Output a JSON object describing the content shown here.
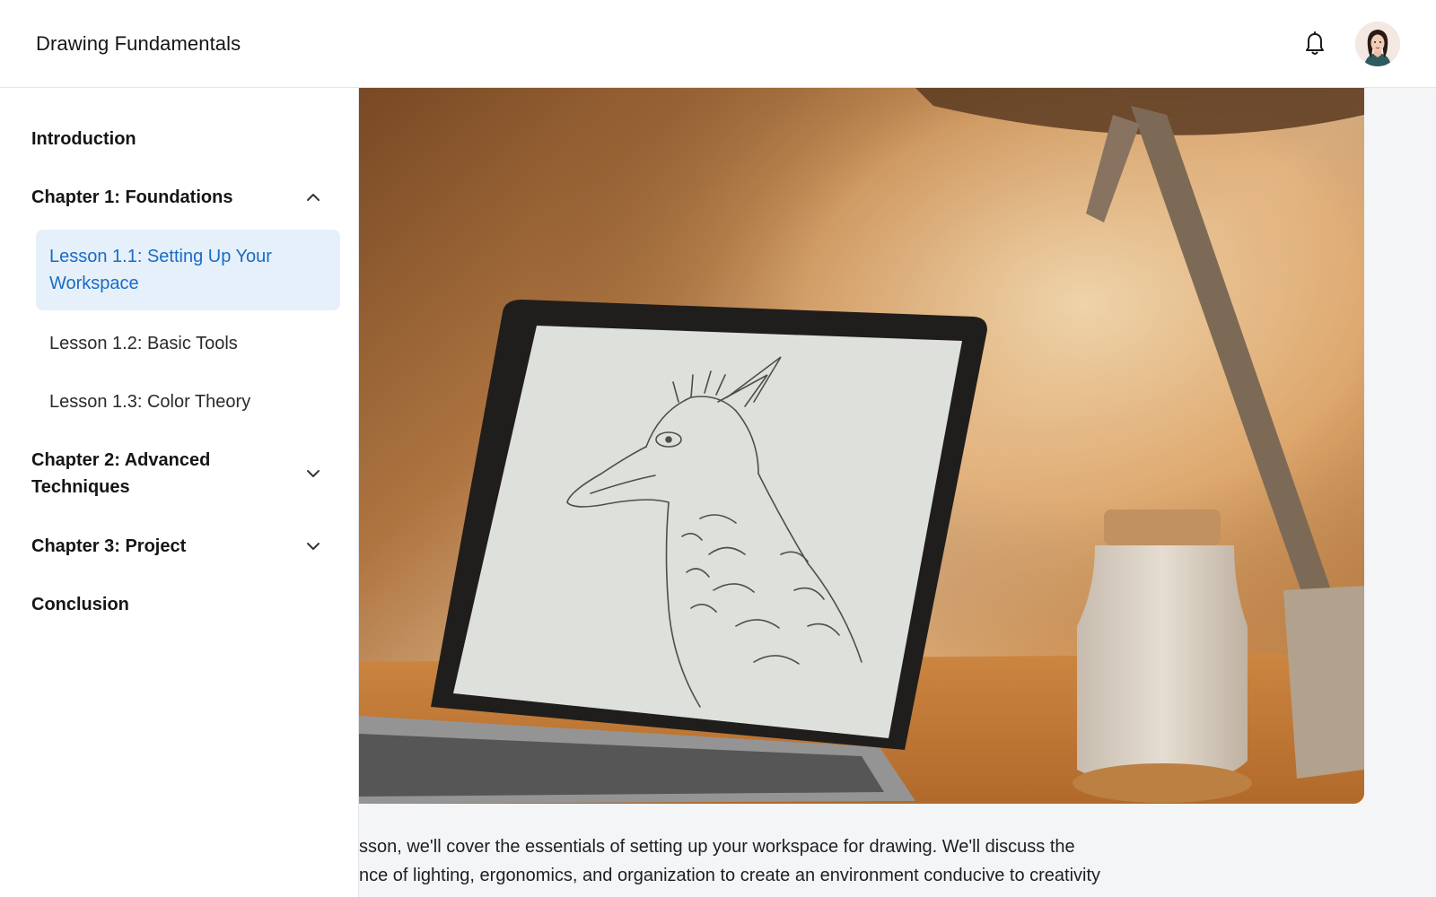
{
  "header": {
    "title": "Drawing Fundamentals",
    "icons": {
      "notifications": "bell-icon",
      "profile": "user-avatar"
    }
  },
  "sidebar": {
    "introduction": "Introduction",
    "chapter1": {
      "label": "Chapter 1: Foundations",
      "expanded": true,
      "lessons": [
        "Lesson 1.1: Setting Up Your Workspace",
        "Lesson 1.2: Basic Tools",
        "Lesson 1.3: Color Theory"
      ],
      "active_lesson": 0
    },
    "chapter2": {
      "label": "Chapter 2: Advanced Techniques",
      "expanded": false
    },
    "chapter3": {
      "label": "Chapter 3: Project",
      "expanded": false
    },
    "conclusion": "Conclusion"
  },
  "content": {
    "body_line1": "sson, we'll cover the essentials of setting up your workspace for drawing. We'll discuss the",
    "body_line2": "nce of lighting, ergonomics, and organization to create an environment conducive to creativity"
  },
  "colors": {
    "accent": "#1a6bc4",
    "active_bg": "#e5f0fb"
  }
}
